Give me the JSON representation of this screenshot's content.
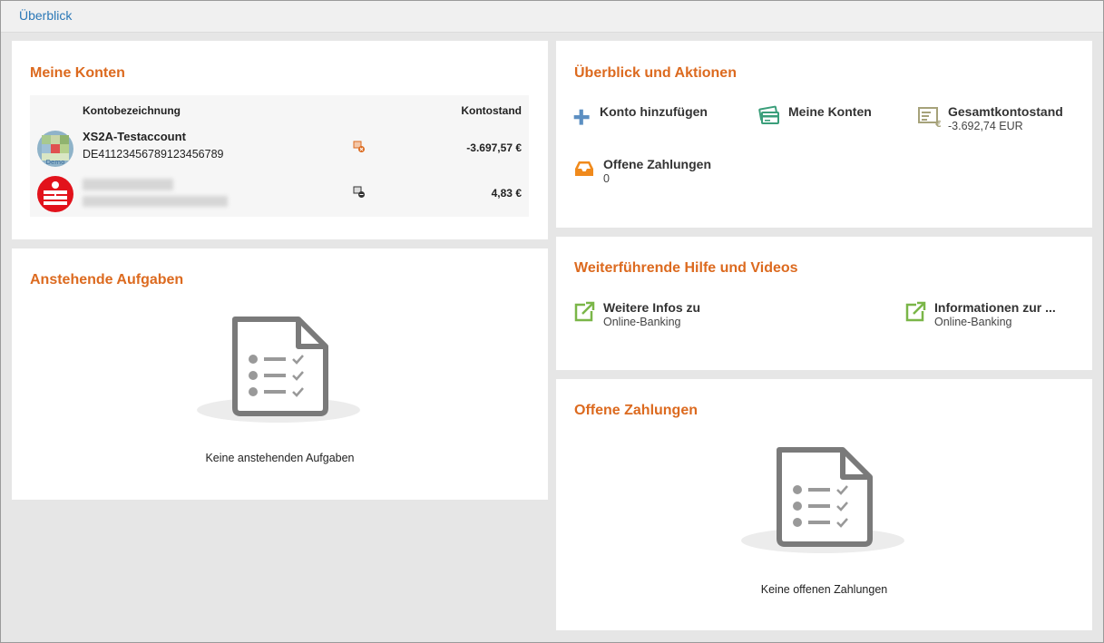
{
  "topbar": {
    "link": "Überblick"
  },
  "konten": {
    "title": "Meine Konten",
    "col_name": "Kontobezeichnung",
    "col_balance": "Kontostand",
    "accounts": [
      {
        "name": "XS2A-Testaccount",
        "iban": "DE41123456789123456789",
        "balance": "-3.697,57 €",
        "logo": "demo-bank-logo"
      },
      {
        "name": "",
        "iban": "",
        "balance": "4,83 €",
        "logo": "sparkasse-logo"
      }
    ]
  },
  "aufgaben": {
    "title": "Anstehende Aufgaben",
    "empty": "Keine anstehenden Aufgaben"
  },
  "aktionen": {
    "title": "Überblick und Aktionen",
    "items": [
      {
        "label": "Konto hinzufügen",
        "sub": "",
        "icon": "plus-icon"
      },
      {
        "label": "Meine Konten",
        "sub": "",
        "icon": "cards-icon"
      },
      {
        "label": "Gesamtkontostand",
        "sub": "-3.692,74 EUR",
        "icon": "balance-icon"
      },
      {
        "label": "Offene Zahlungen",
        "sub": "0",
        "icon": "inbox-icon"
      }
    ]
  },
  "hilfe": {
    "title": "Weiterführende Hilfe und Videos",
    "items": [
      {
        "label": "Weitere Infos zu",
        "sub": "Online-Banking",
        "icon": "external-link-icon"
      },
      {
        "label": "Informationen zur ...",
        "sub": "Online-Banking",
        "icon": "external-link-icon"
      }
    ]
  },
  "zahlungen": {
    "title": "Offene Zahlungen",
    "empty": "Keine offenen Zahlungen"
  },
  "colors": {
    "accent": "#dc6a1f",
    "link": "#2b78b7",
    "green": "#7ab648",
    "background": "#e6e6e6"
  }
}
